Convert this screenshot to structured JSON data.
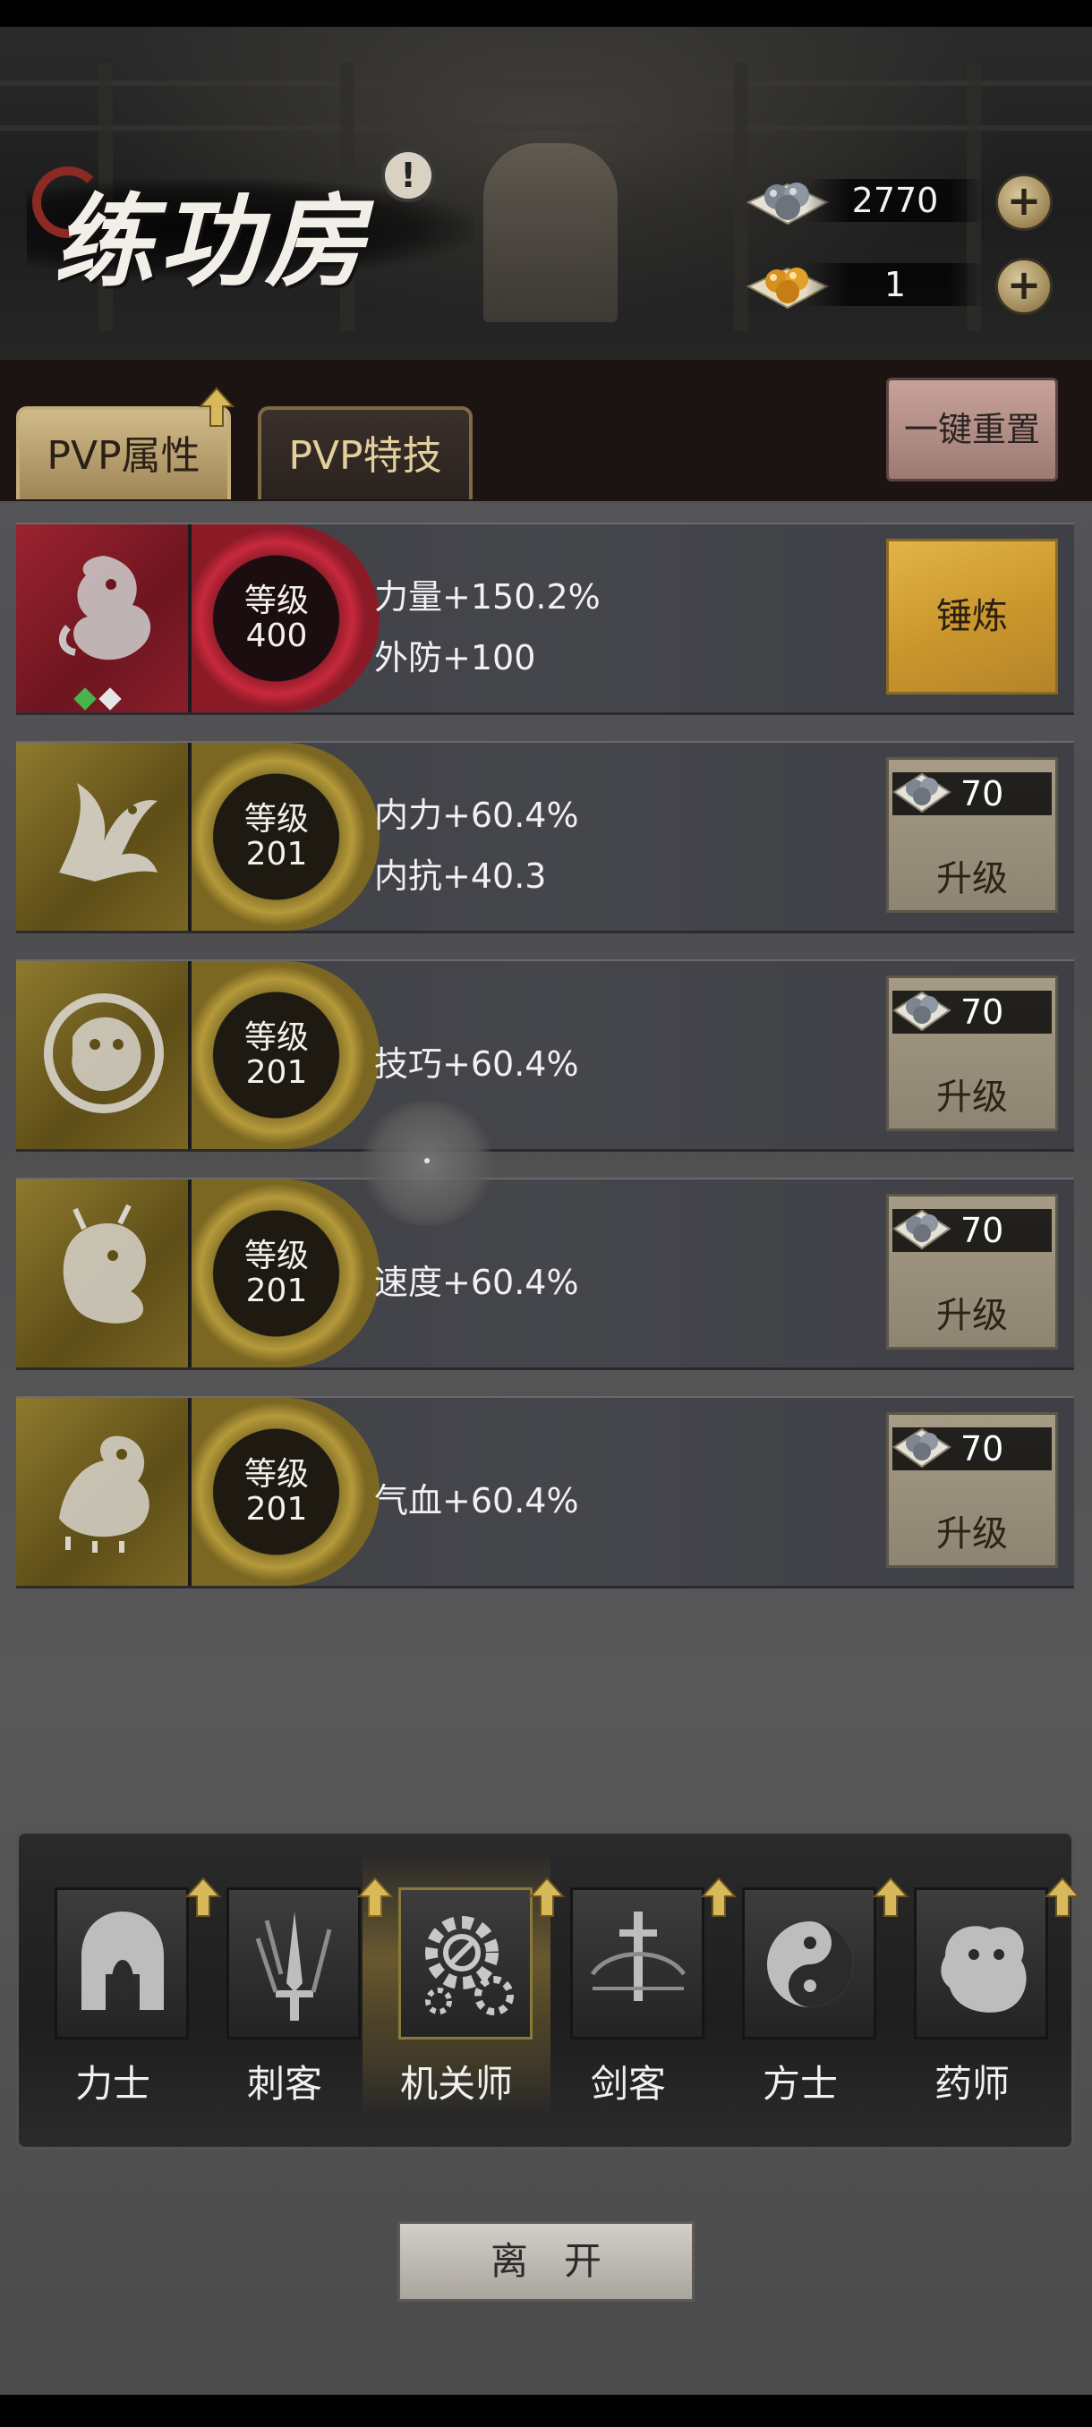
{
  "header": {
    "title": "练功房",
    "info_icon": "!",
    "currencies": [
      {
        "name": "silver-ball-icon",
        "amount": "2770",
        "plus": "+"
      },
      {
        "name": "gold-ball-icon",
        "amount": "1",
        "plus": "+"
      }
    ]
  },
  "tabs": [
    {
      "label": "PVP属性",
      "active": true
    },
    {
      "label": "PVP特技",
      "active": false
    }
  ],
  "reset_label": "一键重置",
  "rows": [
    {
      "emblem": "dragon-icon",
      "style": "red",
      "level_label": "等级",
      "level": "400",
      "stats": [
        "力量+150.2%",
        "外防+100"
      ],
      "action": "锤炼",
      "gems": [
        "green",
        "white"
      ]
    },
    {
      "emblem": "phoenix-icon",
      "style": "gold",
      "level_label": "等级",
      "level": "201",
      "stats": [
        "内力+60.4%",
        "内抗+40.3"
      ],
      "action": "升级",
      "cost": "70"
    },
    {
      "emblem": "tiger-icon",
      "style": "gold",
      "level_label": "等级",
      "level": "201",
      "stats": [
        "技巧+60.4%"
      ],
      "action": "升级",
      "cost": "70"
    },
    {
      "emblem": "qilin-icon",
      "style": "gold",
      "level_label": "等级",
      "level": "201",
      "stats": [
        "速度+60.4%"
      ],
      "action": "升级",
      "cost": "70"
    },
    {
      "emblem": "pixiu-icon",
      "style": "gold",
      "level_label": "等级",
      "level": "201",
      "stats": [
        "气血+60.4%"
      ],
      "action": "升级",
      "cost": "70"
    }
  ],
  "classes": [
    {
      "label": "力士",
      "icon": "helmet-icon",
      "selected": false
    },
    {
      "label": "刺客",
      "icon": "claw-dagger-icon",
      "selected": false
    },
    {
      "label": "机关师",
      "icon": "gear-icon",
      "selected": true
    },
    {
      "label": "剑客",
      "icon": "sword-icon",
      "selected": false
    },
    {
      "label": "方士",
      "icon": "yin-yang-icon",
      "selected": false
    },
    {
      "label": "药师",
      "icon": "gourd-beast-icon",
      "selected": false
    }
  ],
  "leave_label": "离开",
  "colors": {
    "gold_accent": "#c9962c",
    "red_accent": "#9b2330",
    "tab_active": "#d1bb8a",
    "reset_button": "#c7a29a"
  }
}
